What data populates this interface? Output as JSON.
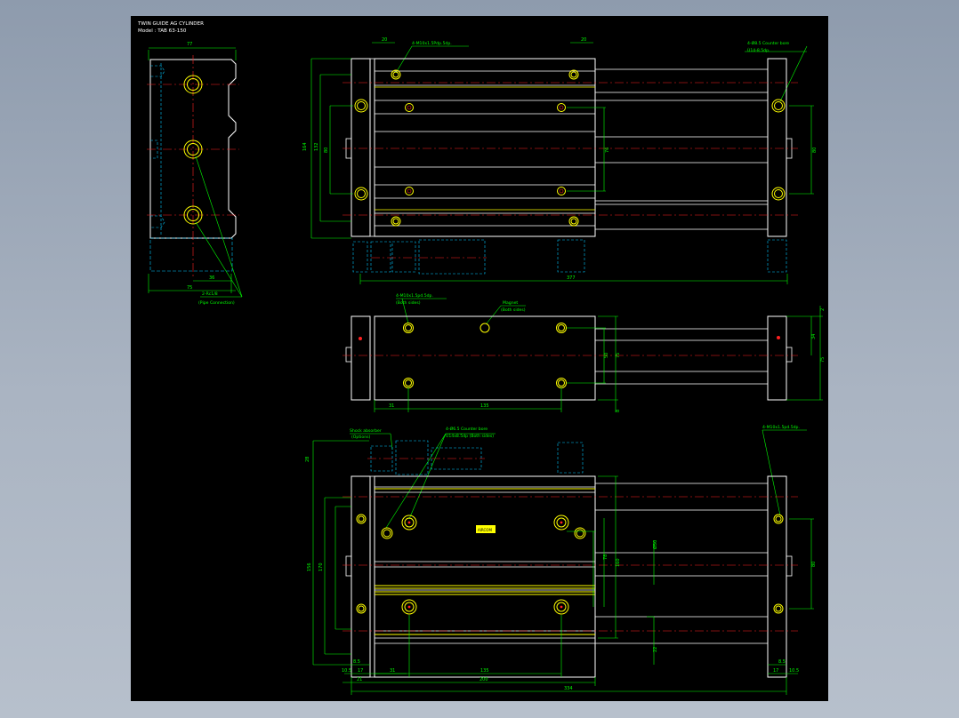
{
  "drawing": {
    "title": "TWIN GUIDE AG CYLINDER",
    "model": "Model : TAB 63-150",
    "colors": {
      "background": "#000000",
      "outline": "#ffffff",
      "dimension": "#00ff00",
      "hole": "#ffff00",
      "centerline": "#ff2020",
      "hidden": "#00c8ff"
    },
    "side_view": {
      "width_top": "77",
      "dim_36": "36",
      "dim_75": "75",
      "port_label": "2-Rc1/8",
      "port_sub": "(Pipe Connection)"
    },
    "top_view": {
      "note_left": "4-M10x1.5Pdp.5dp.",
      "note_right": "4-Ø8.5 Counter bore",
      "note_right_sub": "Ù14-8.5dp.",
      "dim_top_left": "20",
      "dim_top_right": "20",
      "dim_total_length": "377",
      "dim_height_1": "164",
      "dim_height_2": "132",
      "dim_height_3": "80",
      "dim_right_1": "76",
      "dim_right_2": "80"
    },
    "mid_view": {
      "note_tap": "4-M10x1.5pd.5dp.",
      "note_tap_sub": "(Both sides)",
      "note_magnet": "Magnet",
      "note_magnet_sub": "(Both sides)",
      "dim_31": "31",
      "dim_135": "135",
      "dim_50": "50",
      "dim_75": "75",
      "dim_34": "34",
      "dim_2": "2",
      "dim_right": "75",
      "dim_8": "8"
    },
    "bottom_view": {
      "note_shock": "Shock absorber",
      "note_shock_sub": "(Options)",
      "note_counter": "4-Ø6.5 Counter bore",
      "note_counter_sub": "Ù14x8.5dp (Both sides)",
      "note_right": "4-M10x1.5pd.5dp.",
      "dim_28": "28",
      "dim_156": "156",
      "dim_170": "170",
      "dim_31": "31",
      "dim_135": "135",
      "dim_200": "200",
      "dim_334": "334",
      "dim_21": "21",
      "dim_10_5a": "10.5",
      "dim_17a": "17",
      "dim_17b": "17",
      "dim_10_5b": "10.5",
      "dim_8_5a": "8.5",
      "dim_8_5b": "8.5",
      "dim_phi": "Ø50",
      "dim_right_v": "80",
      "dim_22": "22",
      "dim_78": "78",
      "dim_160": "160",
      "label_badge": "AIRCOM"
    }
  }
}
